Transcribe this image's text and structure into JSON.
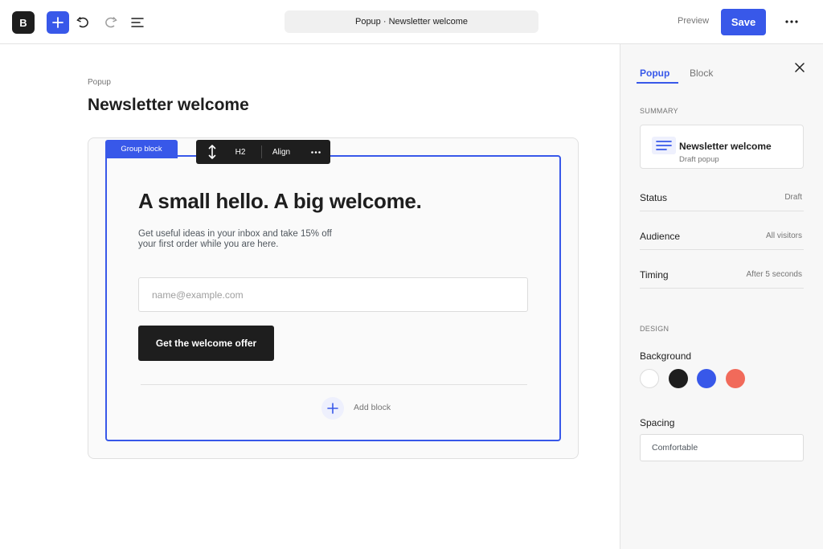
{
  "topbar": {
    "logo_letter": "B",
    "document_title": "Popup · Newsletter welcome",
    "preview_label": "Preview",
    "save_label": "Save"
  },
  "editor": {
    "breadcrumb": "Popup",
    "page_title": "Newsletter welcome",
    "group_tag": "Group block",
    "block_toolbar": {
      "heading_level": "H2",
      "align_label": "Align"
    },
    "hero": {
      "heading": "A small hello. A big welcome.",
      "text": "Get useful ideas in your inbox and take 15% off your first order while you are here.",
      "email_placeholder": "name@example.com",
      "email_value": "",
      "cta_label": "Get the welcome offer"
    },
    "add_block_label": "Add block"
  },
  "sidebar": {
    "tabs": [
      {
        "label": "Popup",
        "active": true
      },
      {
        "label": "Block",
        "active": false
      }
    ],
    "summary_label": "SUMMARY",
    "summary": {
      "name": "Newsletter welcome",
      "subtitle": "Draft popup"
    },
    "properties": [
      {
        "label": "Status",
        "value": "Draft"
      },
      {
        "label": "Audience",
        "value": "All visitors"
      },
      {
        "label": "Timing",
        "value": "After 5 seconds"
      }
    ],
    "design_label": "DESIGN",
    "background_label": "Background",
    "background_swatches": [
      "#ffffff",
      "#1e1e1e",
      "#3858e9",
      "#f16a5a"
    ],
    "spacing_label": "Spacing",
    "spacing_value": "Comfortable"
  },
  "colors": {
    "accent": "#3858e9",
    "dark": "#1e1e1e"
  },
  "icons": [
    "add-icon",
    "undo-icon",
    "redo-icon",
    "list-view-icon",
    "more-icon",
    "move-icon",
    "close-icon",
    "text-align-icon"
  ]
}
